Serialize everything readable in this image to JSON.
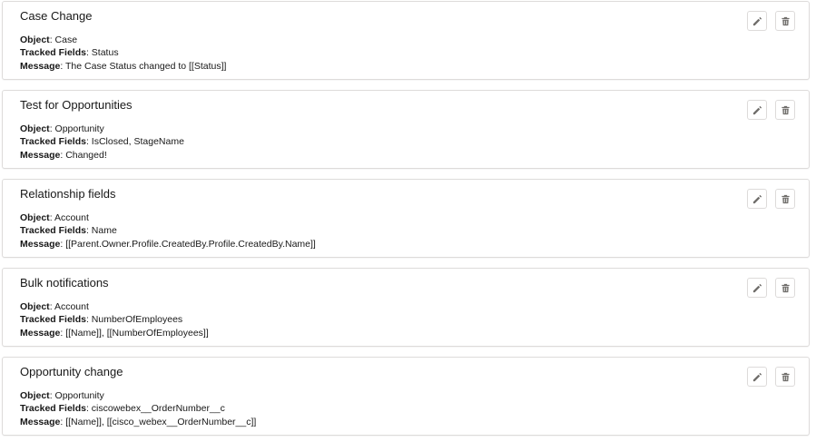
{
  "labels": {
    "object": "Object",
    "tracked_fields": "Tracked Fields",
    "message": "Message"
  },
  "icons": {
    "edit": "pencil-icon",
    "delete": "trash-icon",
    "icon_color": "#706e6b"
  },
  "rules": [
    {
      "title": "Case Change",
      "object": "Case",
      "tracked_fields": "Status",
      "message": "The Case Status changed to [[Status]]"
    },
    {
      "title": "Test for Opportunities",
      "object": "Opportunity",
      "tracked_fields": "IsClosed, StageName",
      "message": "Changed!"
    },
    {
      "title": "Relationship fields",
      "object": "Account",
      "tracked_fields": "Name",
      "message": "[[Parent.Owner.Profile.CreatedBy.Profile.CreatedBy.Name]]"
    },
    {
      "title": "Bulk notifications",
      "object": "Account",
      "tracked_fields": "NumberOfEmployees",
      "message": "[[Name]], [[NumberOfEmployees]]"
    },
    {
      "title": "Opportunity change",
      "object": "Opportunity",
      "tracked_fields": "ciscowebex__OrderNumber__c",
      "message": "[[Name]], [[cisco_webex__OrderNumber__c]]"
    }
  ]
}
